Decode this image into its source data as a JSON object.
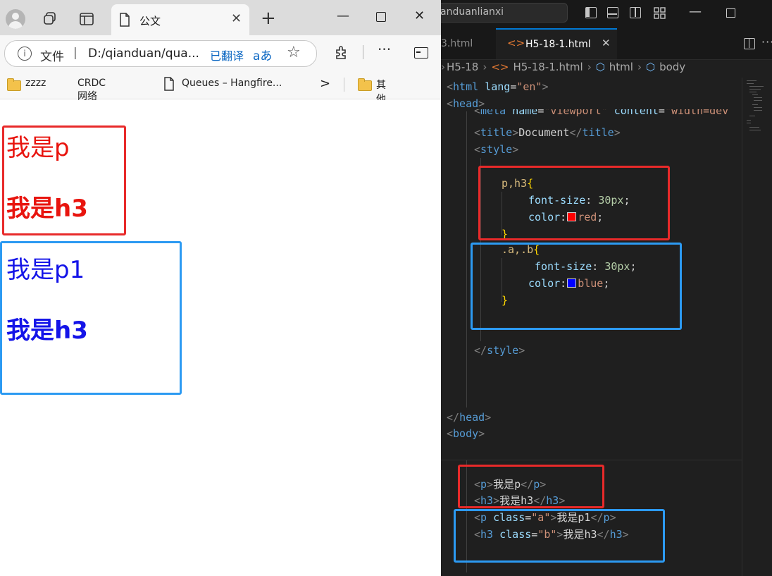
{
  "browser": {
    "tab_title": "公文",
    "address": {
      "scheme_label": "文件",
      "separator": "|",
      "url": "D:/qianduan/qua...",
      "translated_label": "已翻译",
      "translate_glyph": "aあ"
    },
    "bookmarks": [
      {
        "label": "zzzz",
        "icon": "folder-icon"
      },
      {
        "label": "CRDC网络准入",
        "icon": "blank-page-icon"
      },
      {
        "label": "Queues – Hangfire...",
        "icon": "doc-icon"
      }
    ],
    "bookmarks_overflow": ">",
    "bookmarks_other": "其他收藏夹",
    "rendered": {
      "red_group": {
        "p_text": "我是p",
        "h3_text": "我是h3",
        "color": "#e8140e"
      },
      "blue_group": {
        "p_text": "我是p1",
        "h3_text": "我是h3",
        "color": "#1414e8"
      },
      "annotation_colors": {
        "red": "#e82a2a",
        "blue": "#2c9af2"
      }
    }
  },
  "editor": {
    "search_text": "anduanlianxi",
    "tabs": [
      {
        "label": "3.html",
        "active": false
      },
      {
        "label": "H5-18-1.html",
        "active": true,
        "icon": "<>"
      }
    ],
    "breadcrumb": [
      "H5-18",
      "H5-18-1.html",
      "html",
      "body"
    ],
    "code": {
      "html_open": {
        "tag": "html",
        "attr": "lang",
        "value": "\"en\""
      },
      "head_open": "head",
      "meta_partial": {
        "tag": "meta",
        "attr1": "name",
        "value1": "\"viewport\"",
        "attr2": "content",
        "value2": "\"width=dev"
      },
      "title_line": {
        "tag": "title",
        "text": "Document"
      },
      "style_open": "style",
      "rule1": {
        "selector": "p,h3",
        "prop1": "font-size",
        "val1": "30px",
        "prop2": "color",
        "val2": "red",
        "swatch": "#ff0000"
      },
      "rule2": {
        "selector": ".a,.b",
        "prop1": "font-size",
        "val1": "30px",
        "prop2": "color",
        "val2": "blue",
        "swatch": "#0000ff"
      },
      "style_close": "style",
      "head_close": "head",
      "body_open": "body",
      "body_lines": [
        {
          "tag": "p",
          "attr": "",
          "value": "",
          "text": "我是p"
        },
        {
          "tag": "h3",
          "attr": "",
          "value": "",
          "text": "我是h3"
        },
        {
          "tag": "p",
          "attr": "class",
          "value": "\"a\"",
          "text": "我是p1"
        },
        {
          "tag": "h3",
          "attr": "class",
          "value": "\"b\"",
          "text": "我是h3"
        }
      ]
    }
  }
}
